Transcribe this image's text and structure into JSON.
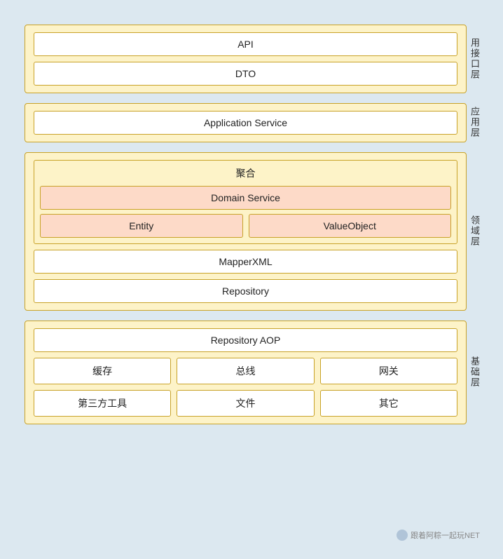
{
  "layers": {
    "interface_layer": {
      "label": "用接口层",
      "boxes": [
        "API",
        "DTO"
      ]
    },
    "application_layer": {
      "label": "应用层",
      "boxes": [
        "Application Service"
      ]
    },
    "domain_layer": {
      "label": "领域层",
      "aggregate": {
        "title": "聚合",
        "domain_service": "Domain Service",
        "entity": "Entity",
        "value_object": "ValueObject"
      },
      "mapper_xml": "MapperXML",
      "repository": "Repository"
    },
    "infrastructure_layer": {
      "label": "基础层",
      "repository_aop": "Repository AOP",
      "row1": [
        "缓存",
        "总线",
        "网关"
      ],
      "row2": [
        "第三方工具",
        "文件",
        "其它"
      ]
    }
  },
  "watermark": {
    "text": "跟着阿粽一起玩NET"
  }
}
